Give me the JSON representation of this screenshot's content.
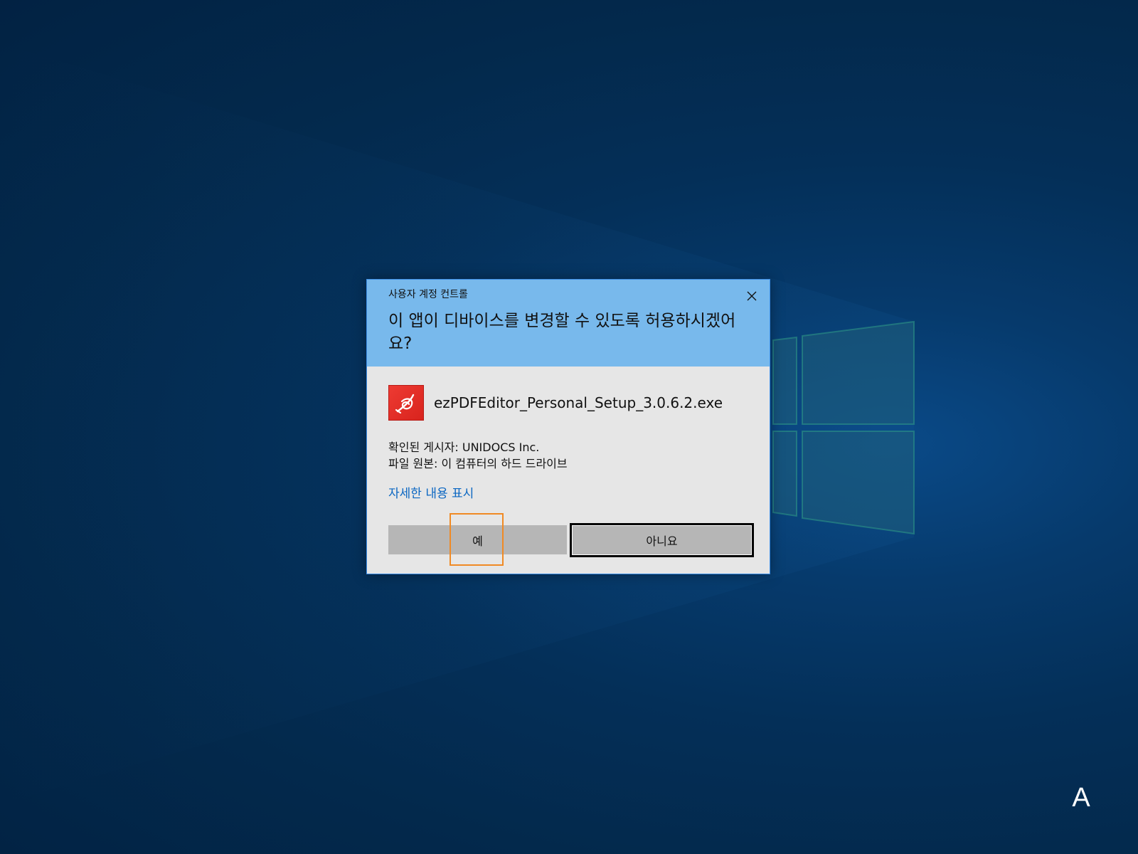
{
  "dialog": {
    "caption": "사용자 계정 컨트롤",
    "question": "이 앱이 디바이스를 변경할 수 있도록 허용하시겠어요?",
    "app_name": "ezPDFEditor_Personal_Setup_3.0.6.2.exe",
    "publisher_line": "확인된 게시자: UNIDOCS Inc.",
    "origin_line": "파일 원본: 이 컴퓨터의 하드 드라이브",
    "details_link": "자세한 내용 표시",
    "yes_label": "예",
    "no_label": "아니요",
    "header_color": "#78b9ec",
    "body_color": "#e6e6e6",
    "link_color": "#0a66c2",
    "app_icon": "ezpdf-logo-icon",
    "close_icon": "close-icon"
  },
  "highlight": {
    "color": "#f08a24"
  },
  "desktop": {
    "ime_indicator": "A",
    "background_color": "#042f58"
  }
}
